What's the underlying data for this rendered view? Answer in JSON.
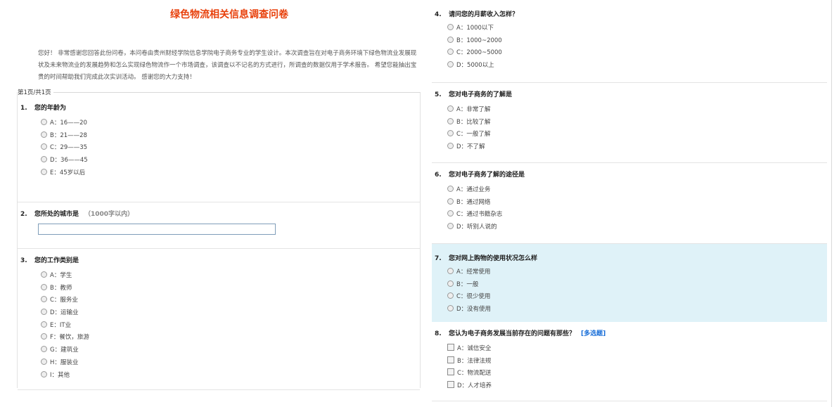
{
  "survey": {
    "title": "绿色物流相关信息调查问卷",
    "intro": "您好！ 非常感谢您回答此份问卷，本问卷由贵州财经学院信息学院电子商务专业的学生设计。本次调查旨在对电子商务环境下绿色物流业发展现状及未来物流业的发展趋势和怎么实现绿色物流作一个市场调查，该调查以不记名的方式进行，所调查的数据仅用于学术报告。 希望您能抽出宝贵的时间帮助我们完成此次实训活动。 感谢您的大力支持！",
    "page_label": "第1页/共1页"
  },
  "questions": [
    {
      "num": "1.",
      "title": "您的年龄为",
      "type": "radio",
      "options": [
        "A：16——20",
        "B：21——28",
        "C：29——35",
        "D：36——45",
        "E：45岁以后"
      ]
    },
    {
      "num": "2.",
      "title": "您所处的城市是",
      "type": "text",
      "hint": "（1000字以内）",
      "value": ""
    },
    {
      "num": "3.",
      "title": "您的工作类别是",
      "type": "radio",
      "options": [
        "A：学生",
        "B：教师",
        "C：服务业",
        "D：运输业",
        "E：IT业",
        "F：餐饮，旅游",
        "G：建筑业",
        "H：服装业",
        "I：其他"
      ]
    },
    {
      "num": "4.",
      "title": "请问您的月薪收入怎样？",
      "type": "radio",
      "options": [
        "A：1000以下",
        "B：1000~2000",
        "C：2000~5000",
        "D：5000以上"
      ]
    },
    {
      "num": "5.",
      "title": "您对电子商务的了解是",
      "type": "radio",
      "options": [
        "A：非常了解",
        "B：比较了解",
        "C：一般了解",
        "D：不了解"
      ]
    },
    {
      "num": "6.",
      "title": "您对电子商务了解的途径是",
      "type": "radio",
      "options": [
        "A：通过业务",
        "B：通过网络",
        "C：通过书籍杂志",
        "D：听别人说的"
      ]
    },
    {
      "num": "7.",
      "title": "您对网上购物的使用状况怎么样",
      "type": "radio",
      "options": [
        "A：经常使用",
        "B：一般",
        "C：很少使用",
        "D：没有使用"
      ]
    },
    {
      "num": "8.",
      "title": "您认为电子商务发展当前存在的问题有那些？",
      "type": "checkbox",
      "tag": "[多选题]",
      "options": [
        "A：诚信安全",
        "B：法律法规",
        "C：物流配送",
        "D：人才培养"
      ]
    }
  ],
  "colors": {
    "title": "#e8410c",
    "highlight": "#dff2f8",
    "multi_tag": "#1a6fd8"
  }
}
